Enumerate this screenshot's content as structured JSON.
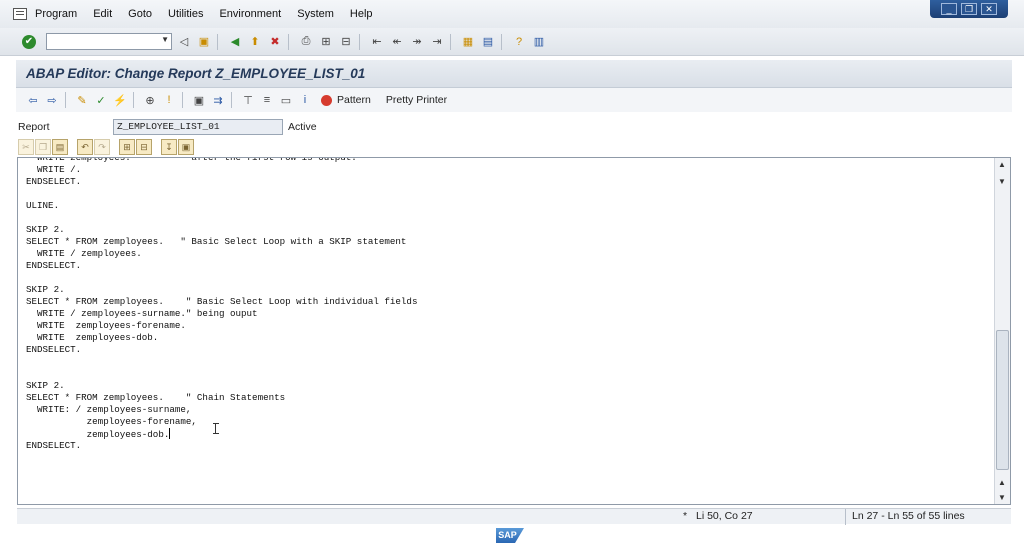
{
  "menu": {
    "items": [
      "Program",
      "Edit",
      "Goto",
      "Utilities",
      "Environment",
      "System",
      "Help"
    ]
  },
  "window_controls": {
    "minimize": "_",
    "restore": "❐",
    "close": "✕"
  },
  "command_field": {
    "value": ""
  },
  "title": "ABAP Editor: Change Report Z_EMPLOYEE_LIST_01",
  "app_toolbar": {
    "pattern_label": "Pattern",
    "pretty_printer_label": "Pretty Printer"
  },
  "report": {
    "label": "Report",
    "value": "Z_EMPLOYEE_LIST_01",
    "status": "Active"
  },
  "code_lines": [
    "  WRITE zemployees.          \"after the first row is output.",
    "  WRITE /.",
    "ENDSELECT.",
    "",
    "ULINE.",
    "",
    "SKIP 2.",
    "SELECT * FROM zemployees.   \" Basic Select Loop with a SKIP statement",
    "  WRITE / zemployees.",
    "ENDSELECT.",
    "",
    "SKIP 2.",
    "SELECT * FROM zemployees.    \" Basic Select Loop with individual fields",
    "  WRITE / zemployees-surname.\" being ouput",
    "  WRITE  zemployees-forename.",
    "  WRITE  zemployees-dob.",
    "ENDSELECT.",
    "",
    "",
    "SKIP 2.",
    "SELECT * FROM zemployees.    \" Chain Statements",
    "  WRITE: / zemployees-surname,",
    "           zemployees-forename,",
    "           zemployees-dob.",
    "ENDSELECT."
  ],
  "status_bar": {
    "marker": "*",
    "cursor": "Li 50, Co 27",
    "range": "Ln 27 - Ln 55 of 55 lines"
  },
  "footer": {
    "logo_text": "SAP"
  },
  "colors": {
    "title_text": "#253a5a",
    "ok_green": "#2e8b2e",
    "stop_red": "#d63b2e",
    "sap_blue": "#2a67b3"
  }
}
